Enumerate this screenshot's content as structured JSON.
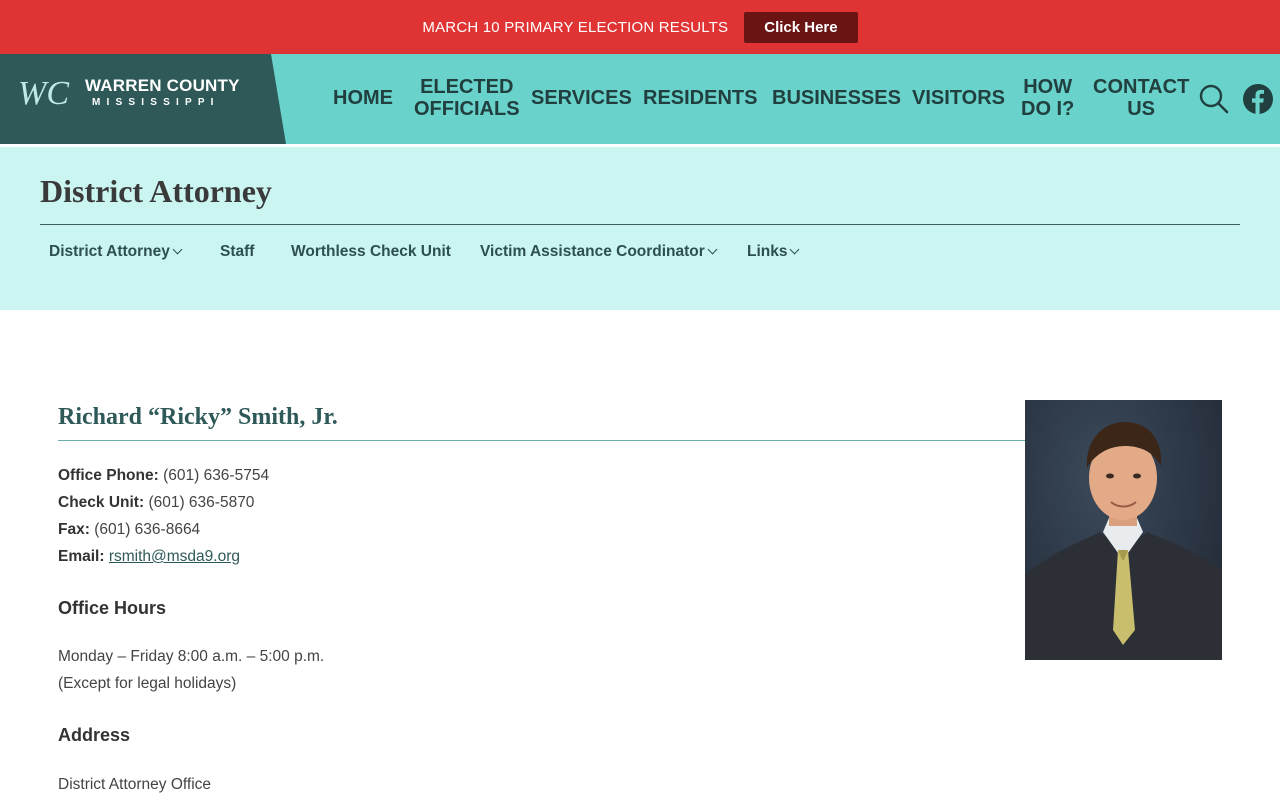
{
  "alert": {
    "text": "MARCH 10 PRIMARY ELECTION RESULTS",
    "button_label": "Click Here",
    "bg_color": "#e03434",
    "button_color": "#6b1414"
  },
  "header": {
    "logo_initials": "WC",
    "logo_name": "WARREN COUNTY",
    "logo_state": "MISSISSIPPI",
    "nav": [
      {
        "label": "HOME"
      },
      {
        "label": "ELECTED",
        "label2": "OFFICIALS"
      },
      {
        "label": "SERVICES"
      },
      {
        "label": "RESIDENTS"
      },
      {
        "label": "BUSINESSES"
      },
      {
        "label": "VISITORS"
      },
      {
        "label": "HOW",
        "label2": "DO I?"
      },
      {
        "label": "CONTACT",
        "label2": "US"
      }
    ],
    "icons": [
      "search-icon",
      "facebook-icon"
    ],
    "bg_color": "#68d2cb",
    "logo_bg": "#2e5958"
  },
  "subheader": {
    "title": "District Attorney",
    "nav": [
      {
        "label": "District Attorney",
        "has_dropdown": true
      },
      {
        "label": "Staff",
        "has_dropdown": false
      },
      {
        "label": "Worthless Check Unit",
        "has_dropdown": false
      },
      {
        "label": "Victim Assistance Coordinator",
        "has_dropdown": true
      },
      {
        "label": "Links",
        "has_dropdown": true
      }
    ],
    "bg_color": "#caf5f1"
  },
  "content": {
    "name": "Richard “Ricky” Smith, Jr.",
    "contacts": [
      {
        "label": "Office Phone:",
        "value": "(601) 636-5754"
      },
      {
        "label": "Check Unit:",
        "value": "(601) 636-5870"
      },
      {
        "label": "Fax:",
        "value": "(601) 636-8664"
      },
      {
        "label": "Email:",
        "value": "rsmith@msda9.org"
      }
    ],
    "office_hours_heading": "Office Hours",
    "office_hours": [
      "Monday – Friday 8:00 a.m. – 5:00 p.m.",
      "(Except for legal holidays)"
    ],
    "address_heading": "Address",
    "address": [
      "District Attorney Office"
    ]
  }
}
